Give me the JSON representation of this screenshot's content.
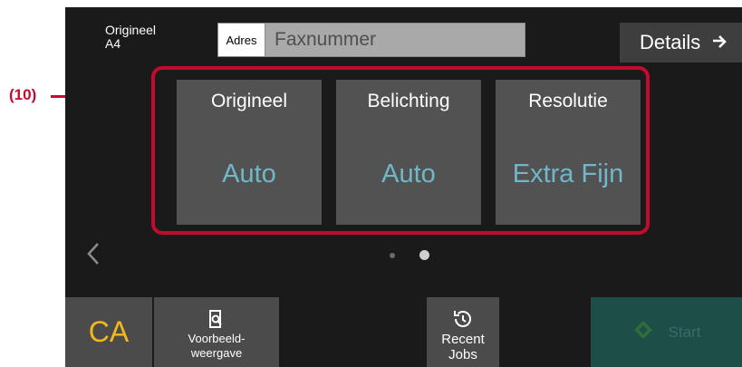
{
  "callout": {
    "label": "(10)"
  },
  "header": {
    "original_label": "Origineel",
    "original_size": "A4",
    "address_label": "Adres",
    "address_placeholder": "Faxnummer",
    "details_label": "Details",
    "details_icon": "arrow-right-icon"
  },
  "tiles": [
    {
      "title": "Origineel",
      "value": "Auto"
    },
    {
      "title": "Belichting",
      "value": "Auto"
    },
    {
      "title": "Resolutie",
      "value": "Extra Fijn"
    }
  ],
  "pager": {
    "prev_icon": "chevron-left-icon",
    "page_count": 2,
    "active_page": 2
  },
  "bottom_bar": {
    "ca_label": "CA",
    "preview_line1": "Voorbeeld-",
    "preview_line2": "weergave",
    "preview_icon": "document-magnifier-icon",
    "recent_line1": "Recent",
    "recent_line2": "Jobs",
    "recent_icon": "history-icon",
    "start_label": "Start",
    "start_icon": "diamond-start-icon"
  },
  "colors": {
    "callout": "#c40a2f",
    "accent_value": "#6fb8c9",
    "ca_text": "#f3b81a",
    "start_bg": "#1d4f48"
  }
}
